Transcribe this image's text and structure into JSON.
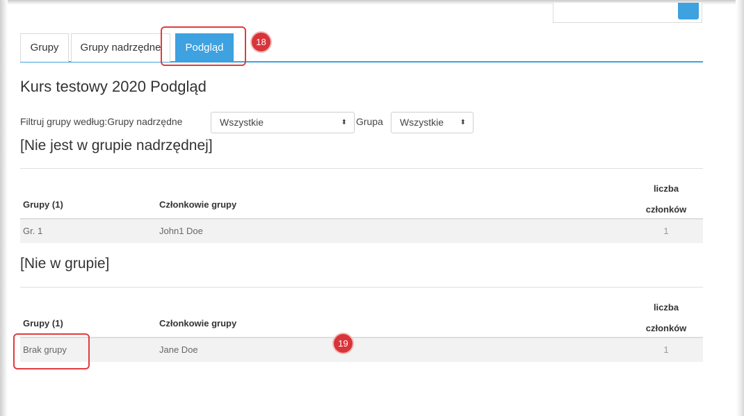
{
  "tabs": [
    {
      "label": "Grupy",
      "active": false
    },
    {
      "label": "Grupy nadrzędne",
      "active": false
    },
    {
      "label": "Podgląd",
      "active": true
    }
  ],
  "badges": [
    "18",
    "19"
  ],
  "page_title": "Kurs testowy 2020 Podgląd",
  "filter": {
    "label": "Filtruj grupy według:Grupy nadrzędne",
    "parent_select_value": "Wszystkie",
    "group_label": "Grupa",
    "group_select_value": "Wszystkie"
  },
  "sections": [
    {
      "title": "[Nie jest w grupie nadrzędnej]",
      "headers": {
        "groups": "Grupy (1)",
        "members": "Członkowie grupy",
        "count_line1": "liczba",
        "count_line2": "członków"
      },
      "rows": [
        {
          "group": "Gr. 1",
          "members": "John1 Doe",
          "count": "1"
        }
      ]
    },
    {
      "title": "[Nie w grupie]",
      "headers": {
        "groups": "Grupy (1)",
        "members": "Członkowie grupy",
        "count_line1": "liczba",
        "count_line2": "członków"
      },
      "rows": [
        {
          "group": "Brak grupy",
          "members": "Jane Doe",
          "count": "1"
        }
      ]
    }
  ],
  "colors": {
    "accent": "#3ea1e0",
    "highlight": "#e23b3b",
    "badge": "#d8343a"
  }
}
